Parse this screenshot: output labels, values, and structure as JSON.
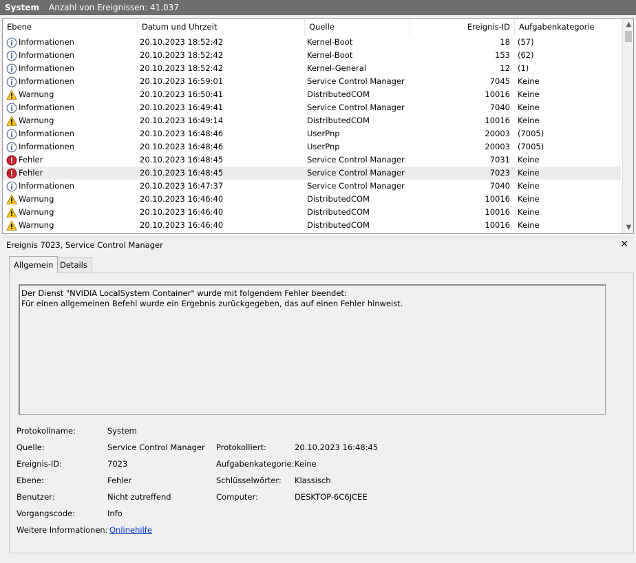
{
  "titlebar": {
    "title": "System",
    "event_count": "Anzahl von Ereignissen: 41.037"
  },
  "table": {
    "columns": [
      "Ebene",
      "Datum und Uhrzeit",
      "Quelle",
      "Ereignis-ID",
      "Aufgabenkategorie"
    ],
    "rows": [
      {
        "level": "Informationen",
        "type": "info",
        "date": "20.10.2023 18:52:42",
        "source": "Kernel-Boot",
        "id": "18",
        "category": "(57)"
      },
      {
        "level": "Informationen",
        "type": "info",
        "date": "20.10.2023 18:52:42",
        "source": "Kernel-Boot",
        "id": "153",
        "category": "(62)"
      },
      {
        "level": "Informationen",
        "type": "info",
        "date": "20.10.2023 18:52:42",
        "source": "Kernel-General",
        "id": "12",
        "category": "(1)"
      },
      {
        "level": "Informationen",
        "type": "info",
        "date": "20.10.2023 16:59:01",
        "source": "Service Control Manager",
        "id": "7045",
        "category": "Keine"
      },
      {
        "level": "Warnung",
        "type": "warning",
        "date": "20.10.2023 16:50:41",
        "source": "DistributedCOM",
        "id": "10016",
        "category": "Keine"
      },
      {
        "level": "Informationen",
        "type": "info",
        "date": "20.10.2023 16:49:41",
        "source": "Service Control Manager",
        "id": "7040",
        "category": "Keine"
      },
      {
        "level": "Warnung",
        "type": "warning",
        "date": "20.10.2023 16:49:14",
        "source": "DistributedCOM",
        "id": "10016",
        "category": "Keine"
      },
      {
        "level": "Informationen",
        "type": "info",
        "date": "20.10.2023 16:48:46",
        "source": "UserPnp",
        "id": "20003",
        "category": "(7005)"
      },
      {
        "level": "Informationen",
        "type": "info",
        "date": "20.10.2023 16:48:46",
        "source": "UserPnp",
        "id": "20003",
        "category": "(7005)"
      },
      {
        "level": "Fehler",
        "type": "error",
        "date": "20.10.2023 16:48:45",
        "source": "Service Control Manager",
        "id": "7031",
        "category": "Keine"
      },
      {
        "level": "Fehler",
        "type": "error",
        "date": "20.10.2023 16:48:45",
        "source": "Service Control Manager",
        "id": "7023",
        "category": "Keine",
        "selected": true
      },
      {
        "level": "Informationen",
        "type": "info",
        "date": "20.10.2023 16:47:37",
        "source": "Service Control Manager",
        "id": "7040",
        "category": "Keine"
      },
      {
        "level": "Warnung",
        "type": "warning",
        "date": "20.10.2023 16:46:40",
        "source": "DistributedCOM",
        "id": "10016",
        "category": "Keine"
      },
      {
        "level": "Warnung",
        "type": "warning",
        "date": "20.10.2023 16:46:40",
        "source": "DistributedCOM",
        "id": "10016",
        "category": "Keine"
      },
      {
        "level": "Warnung",
        "type": "warning",
        "date": "20.10.2023 16:46:40",
        "source": "DistributedCOM",
        "id": "10016",
        "category": "Keine"
      }
    ]
  },
  "detail": {
    "title": "Ereignis 7023, Service Control Manager",
    "close_glyph": "✕",
    "tabs": [
      "Allgemein",
      "Details"
    ],
    "message_line1": "Der Dienst \"NVIDIA LocalSystem Container\" wurde mit folgendem Fehler beendet:",
    "message_line2": "Für einen allgemeinen Befehl wurde ein Ergebnis zurückgegeben, das auf einen Fehler hinweist.",
    "fields": {
      "log_name_label": "Protokollname:",
      "log_name": "System",
      "source_label": "Quelle:",
      "source": "Service Control Manager",
      "logged_label": "Protokolliert:",
      "logged": "20.10.2023 16:48:45",
      "event_id_label": "Ereignis-ID:",
      "event_id": "7023",
      "task_category_label": "Aufgabenkategorie:",
      "task_category": "Keine",
      "level_label": "Ebene:",
      "level": "Fehler",
      "keywords_label": "Schlüsselwörter:",
      "keywords": "Klassisch",
      "user_label": "Benutzer:",
      "user": "Nicht zutreffend",
      "computer_label": "Computer:",
      "computer": "DESKTOP-6C6JCEE",
      "opcode_label": "Vorgangscode:",
      "opcode": "Info",
      "more_info_label": "Weitere Informationen:",
      "more_info_link": "Onlinehilfe"
    }
  },
  "colors": {
    "titlebar": "#6d6d6d",
    "info": "#4a74b8",
    "warning": "#f5c518",
    "error": "#c8202a",
    "link": "#0033cc"
  }
}
